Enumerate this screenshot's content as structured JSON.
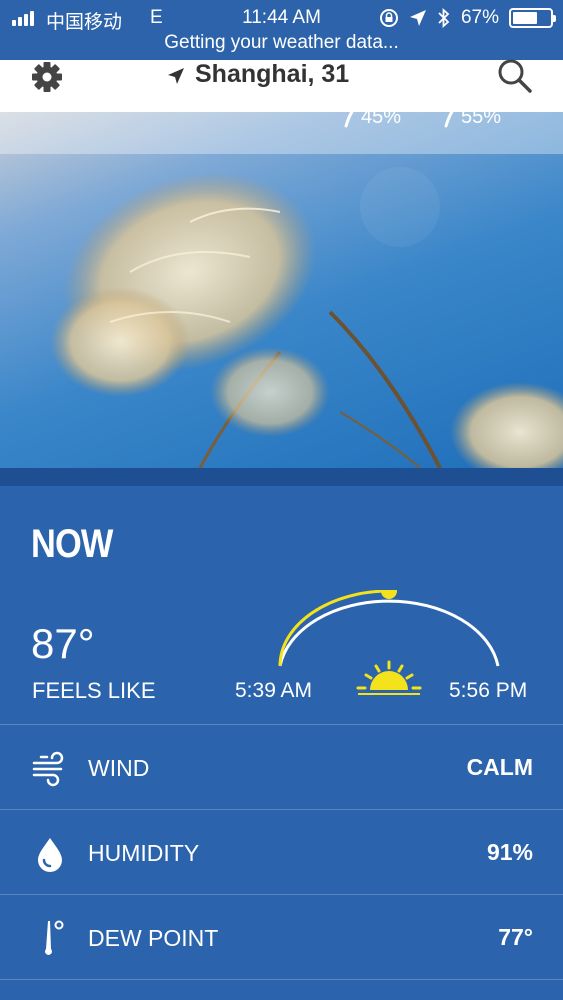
{
  "status_bar": {
    "carrier": "中国移动",
    "network": "E",
    "time": "11:44 AM",
    "battery": "67%",
    "battery_level": 0.67,
    "message": "Getting your weather data..."
  },
  "header": {
    "location": "Shanghai, 31"
  },
  "hero_strip": {
    "left_value": "45%",
    "right_value": "55%"
  },
  "now": {
    "title": "NOW",
    "temperature": "87°",
    "feels_like_label": "FEELS LIKE",
    "sunrise": "5:39 AM",
    "sunset": "5:56 PM",
    "sun_progress": 0.5
  },
  "conditions": [
    {
      "label": "WIND",
      "value": "CALM",
      "icon": "wind-icon"
    },
    {
      "label": "HUMIDITY",
      "value": "91%",
      "icon": "water-drop-icon"
    },
    {
      "label": "DEW POINT",
      "value": "77°",
      "icon": "thermometer-icon"
    }
  ],
  "colors": {
    "panel": "#2b64ac",
    "accent_sun": "#f4e21c"
  }
}
